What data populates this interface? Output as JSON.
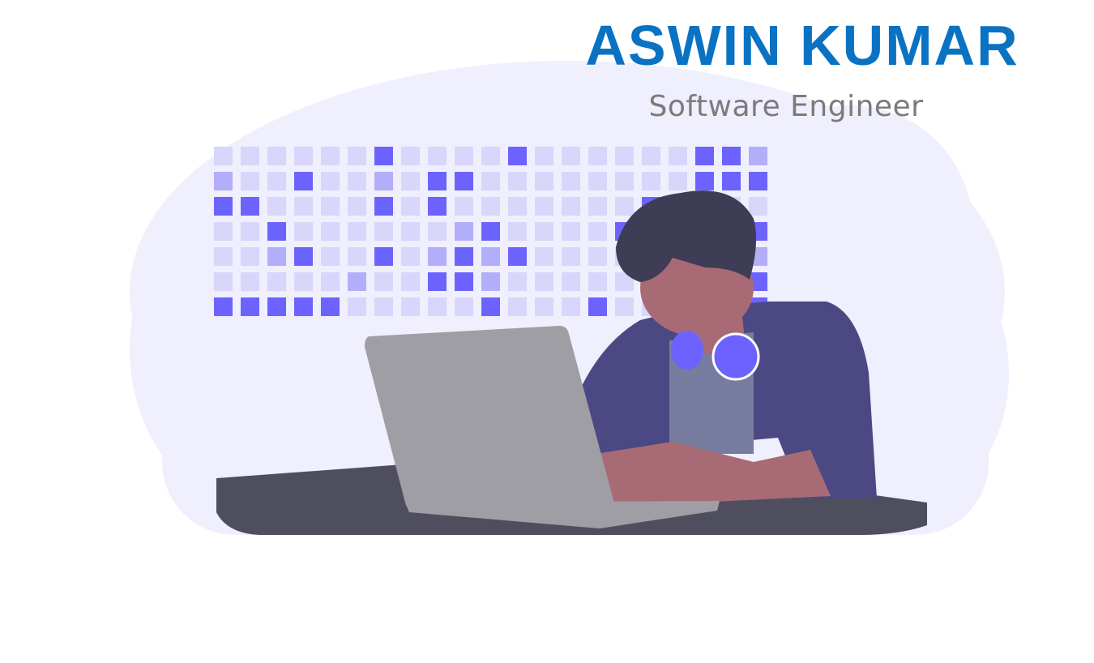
{
  "header": {
    "name": "ASWIN KUMAR",
    "role": "Software Engineer"
  },
  "colors": {
    "name": "#0a72c2",
    "role": "#7b7b7b",
    "cloud": "#efeffd",
    "tile_light": "#d8d6fb",
    "tile_mid": "#b3aefa",
    "tile_dark": "#6c63ff",
    "desk": "#4f4e5e",
    "laptop": "#9f9ea4",
    "hair": "#3f3d56",
    "skin": "#a86b76",
    "jacket": "#4b4883",
    "shirt": "#787c9e"
  },
  "illustration": {
    "subject": "person-working-on-laptop",
    "pattern_grid": [
      "000000200002000000221",
      "100200102200000000222",
      "220000202000000022200",
      "002000000120000200002",
      "001200201212000001001",
      "000001002210000000002",
      "222220000020002000002"
    ]
  }
}
